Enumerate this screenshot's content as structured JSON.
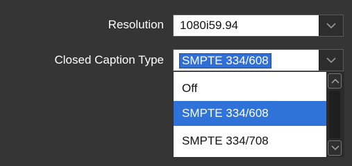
{
  "resolution": {
    "label": "Resolution",
    "value": "1080i59.94"
  },
  "closed_caption": {
    "label": "Closed Caption Type",
    "value": "SMPTE 334/608",
    "options": [
      "Off",
      "SMPTE 334/608",
      "SMPTE 334/708"
    ],
    "highlighted_option": "SMPTE 334/608"
  },
  "icons": {
    "combo_arrow": "chevron-down-icon",
    "scroll_up": "scroll-up-arrow-icon",
    "scroll_down": "scroll-down-arrow-icon"
  },
  "colors": {
    "background": "#353535",
    "highlight": "#2f72d8",
    "text_on_dark": "#ffffff"
  }
}
